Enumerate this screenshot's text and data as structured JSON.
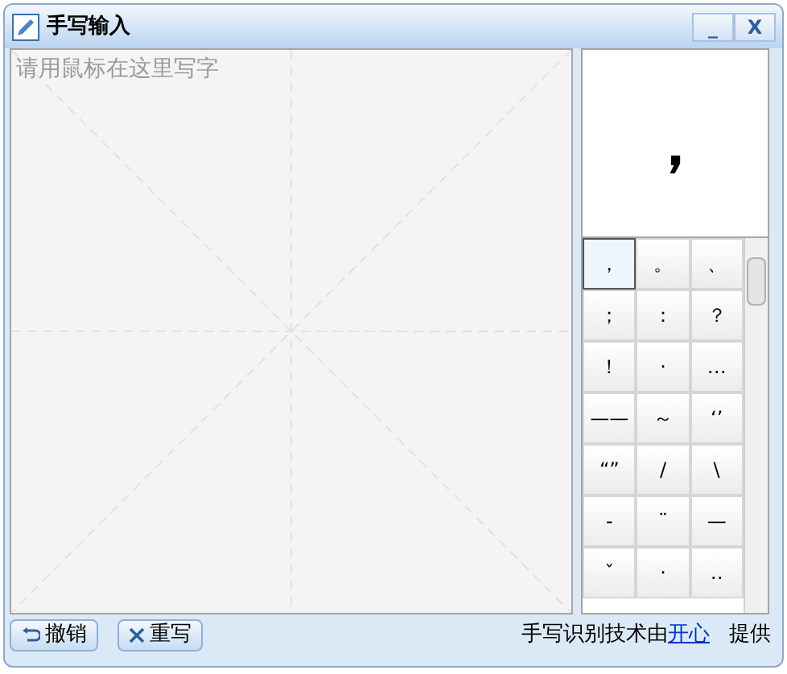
{
  "window": {
    "title": "手写输入",
    "buttons": [
      "_",
      "X"
    ]
  },
  "canvas": {
    "placeholder": "请用鼠标在这里写字"
  },
  "preview": {
    "character": "，"
  },
  "symbols": [
    {
      "label": "，",
      "selected": true
    },
    {
      "label": "。",
      "selected": false
    },
    {
      "label": "、",
      "selected": false
    },
    {
      "label": "；",
      "selected": false
    },
    {
      "label": "：",
      "selected": false
    },
    {
      "label": "？",
      "selected": false
    },
    {
      "label": "！",
      "selected": false
    },
    {
      "label": "·",
      "selected": false
    },
    {
      "label": "…",
      "selected": false
    },
    {
      "label": "——",
      "selected": false
    },
    {
      "label": "～",
      "selected": false
    },
    {
      "label": "‘’",
      "selected": false
    },
    {
      "label": "“”",
      "selected": false
    },
    {
      "label": "/",
      "selected": false
    },
    {
      "label": "\\",
      "selected": false
    },
    {
      "label": "-",
      "selected": false
    },
    {
      "label": "¨",
      "selected": false
    },
    {
      "label": "—",
      "selected": false
    },
    {
      "label": "ˇ",
      "selected": false
    },
    {
      "label": "·",
      "selected": false
    },
    {
      "label": "‥",
      "selected": false
    }
  ],
  "buttons": [
    {
      "label": "撤销",
      "kind": "undo"
    },
    {
      "label": "重写",
      "kind": "clear"
    }
  ],
  "footer": {
    "text": "手写识别技术由",
    "link": "开心",
    "suffix": "提供"
  }
}
